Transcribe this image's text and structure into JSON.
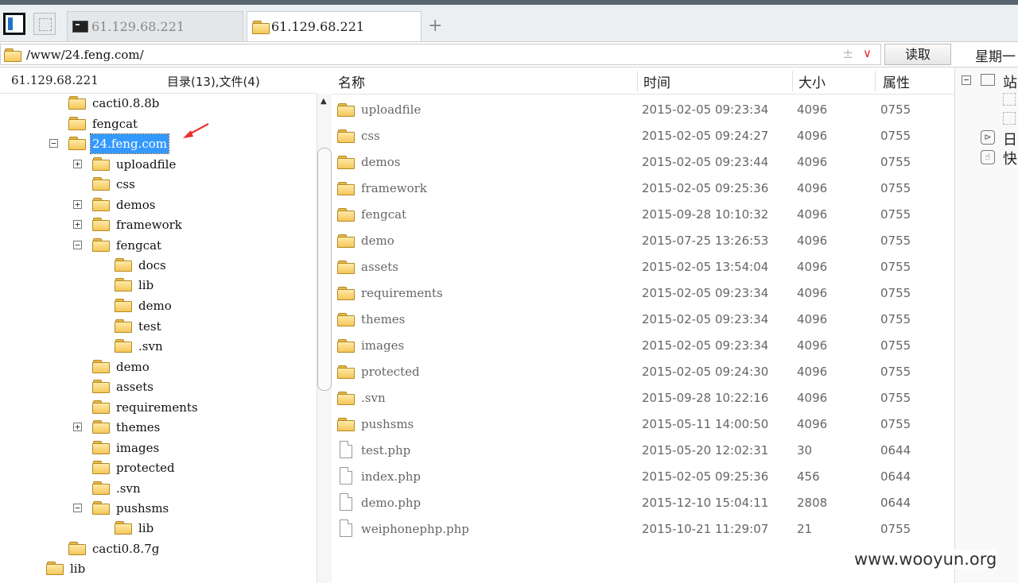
{
  "tabs": [
    {
      "label": "61.129.68.221",
      "active": false
    },
    {
      "label": "61.129.68.221",
      "active": true
    }
  ],
  "toolbar": {
    "add_tab": "+"
  },
  "path": {
    "value": "/www/24.feng.com/",
    "plusminus": "±",
    "dropdown": "∨",
    "read_label": "读取"
  },
  "right_header": {
    "weekday": "星期一"
  },
  "left_panel": {
    "host": "61.129.68.221",
    "counts": "目录(13),文件(4)"
  },
  "tree": [
    {
      "label": "cacti0.8.8b",
      "expander": ""
    },
    {
      "label": "fengcat",
      "expander": ""
    },
    {
      "label": "24.feng.com",
      "expander": "−",
      "selected": true
    },
    {
      "label": "uploadfile",
      "expander": "+"
    },
    {
      "label": "css",
      "expander": ""
    },
    {
      "label": "demos",
      "expander": "+"
    },
    {
      "label": "framework",
      "expander": "+"
    },
    {
      "label": "fengcat",
      "expander": "−"
    },
    {
      "label": "docs",
      "expander": ""
    },
    {
      "label": "lib",
      "expander": ""
    },
    {
      "label": "demo",
      "expander": ""
    },
    {
      "label": "test",
      "expander": ""
    },
    {
      "label": ".svn",
      "expander": ""
    },
    {
      "label": "demo",
      "expander": ""
    },
    {
      "label": "assets",
      "expander": ""
    },
    {
      "label": "requirements",
      "expander": ""
    },
    {
      "label": "themes",
      "expander": "+"
    },
    {
      "label": "images",
      "expander": ""
    },
    {
      "label": "protected",
      "expander": ""
    },
    {
      "label": ".svn",
      "expander": ""
    },
    {
      "label": "pushsms",
      "expander": "−"
    },
    {
      "label": "lib",
      "expander": ""
    },
    {
      "label": "cacti0.8.7g",
      "expander": ""
    },
    {
      "label": "lib",
      "expander": ""
    }
  ],
  "list": {
    "columns": [
      "名称",
      "时间",
      "大小",
      "属性"
    ],
    "rows": [
      {
        "name": "uploadfile",
        "type": "folder",
        "time": "2015-02-05 09:23:34",
        "size": "4096",
        "perm": "0755"
      },
      {
        "name": "css",
        "type": "folder",
        "time": "2015-02-05 09:24:27",
        "size": "4096",
        "perm": "0755"
      },
      {
        "name": "demos",
        "type": "folder",
        "time": "2015-02-05 09:23:44",
        "size": "4096",
        "perm": "0755"
      },
      {
        "name": "framework",
        "type": "folder",
        "time": "2015-02-05 09:25:36",
        "size": "4096",
        "perm": "0755"
      },
      {
        "name": "fengcat",
        "type": "folder",
        "time": "2015-09-28 10:10:32",
        "size": "4096",
        "perm": "0755"
      },
      {
        "name": "demo",
        "type": "folder",
        "time": "2015-07-25 13:26:53",
        "size": "4096",
        "perm": "0755"
      },
      {
        "name": "assets",
        "type": "folder",
        "time": "2015-02-05 13:54:04",
        "size": "4096",
        "perm": "0755"
      },
      {
        "name": "requirements",
        "type": "folder",
        "time": "2015-02-05 09:23:34",
        "size": "4096",
        "perm": "0755"
      },
      {
        "name": "themes",
        "type": "folder",
        "time": "2015-02-05 09:23:34",
        "size": "4096",
        "perm": "0755"
      },
      {
        "name": "images",
        "type": "folder",
        "time": "2015-02-05 09:23:34",
        "size": "4096",
        "perm": "0755"
      },
      {
        "name": "protected",
        "type": "folder",
        "time": "2015-02-05 09:24:30",
        "size": "4096",
        "perm": "0755"
      },
      {
        "name": ".svn",
        "type": "folder",
        "time": "2015-09-28 10:22:16",
        "size": "4096",
        "perm": "0755"
      },
      {
        "name": "pushsms",
        "type": "folder",
        "time": "2015-05-11 14:00:50",
        "size": "4096",
        "perm": "0755"
      },
      {
        "name": "test.php",
        "type": "file",
        "time": "2015-05-20 12:02:31",
        "size": "30",
        "perm": "0644"
      },
      {
        "name": "index.php",
        "type": "file",
        "time": "2015-02-05 09:25:36",
        "size": "456",
        "perm": "0644"
      },
      {
        "name": "demo.php",
        "type": "file",
        "time": "2015-12-10 15:04:11",
        "size": "2808",
        "perm": "0644"
      },
      {
        "name": "weiphonephp.php",
        "type": "file",
        "time": "2015-10-21 11:29:07",
        "size": "21",
        "perm": "0755"
      }
    ]
  },
  "right_panel": {
    "site_label": "站",
    "day_label": "日",
    "quick_label": "快"
  },
  "watermark": "www.wooyun.org",
  "colors": {
    "selection": "#3399ff",
    "folder": "#f5c75a",
    "arrow": "#e8322f"
  }
}
